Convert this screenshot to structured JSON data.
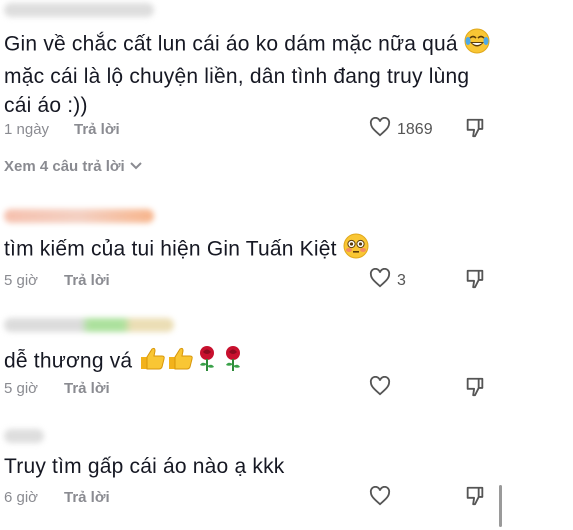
{
  "comments": [
    {
      "text": "Gin về chắc cất lun cái áo ko dám mặc nữa quá",
      "text2": "mặc cái là lộ chuyện liền, dân tình đang truy lùng",
      "text3": "cái áo :))",
      "time": "1 ngày",
      "reply": "Trả lời",
      "likes": "1869",
      "view_replies": "Xem 4 câu trả lời",
      "emoji": "laughing-tears-icon"
    },
    {
      "text": "tìm kiếm của tui hiện Gin Tuấn Kiệt",
      "time": "5 giờ",
      "reply": "Trả lời",
      "likes": "3",
      "emoji": "flushed-face-icon"
    },
    {
      "text": "dễ thương vá",
      "time": "5 giờ",
      "reply": "Trả lời",
      "likes": "",
      "emoji": "thumbs-up-rose-icons"
    },
    {
      "text": "Truy tìm gấp cái áo nào ạ kkk",
      "time": "6 giờ",
      "reply": "Trả lời",
      "likes": ""
    }
  ],
  "colors": {
    "meta": "#8a8b91",
    "text": "#161823"
  }
}
